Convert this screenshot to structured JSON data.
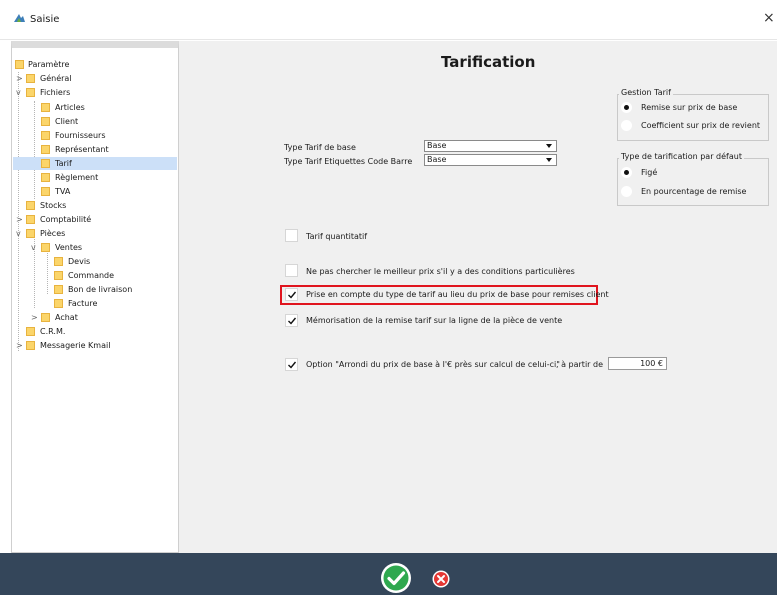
{
  "window": {
    "title": "Saisie",
    "close_glyph": "×"
  },
  "icons": {
    "app": "app-logo-icon",
    "close": "close-icon",
    "folder": "folder-icon",
    "ok": "ok-check-icon",
    "cancel": "cancel-x-icon"
  },
  "colors": {
    "footer": "#34465a",
    "panel": "#f0f0f0",
    "selected": "#cce0f8",
    "highlight": "#e0141e",
    "folder": "#fbd56a",
    "ok": "#2fa84f",
    "cancel": "#e53935"
  },
  "tree": {
    "items": [
      {
        "label": "Paramètre"
      },
      {
        "label": "Général",
        "toggle": ">"
      },
      {
        "label": "Fichiers",
        "toggle": "v"
      },
      {
        "label": "Articles"
      },
      {
        "label": "Client"
      },
      {
        "label": "Fournisseurs"
      },
      {
        "label": "Représentant"
      },
      {
        "label": "Tarif",
        "selected": true
      },
      {
        "label": "Règlement"
      },
      {
        "label": "TVA"
      },
      {
        "label": "Stocks"
      },
      {
        "label": "Comptabilité",
        "toggle": ">"
      },
      {
        "label": "Pièces",
        "toggle": "v"
      },
      {
        "label": "Ventes",
        "toggle": "v"
      },
      {
        "label": "Devis"
      },
      {
        "label": "Commande"
      },
      {
        "label": "Bon de livraison"
      },
      {
        "label": "Facture"
      },
      {
        "label": "Achat",
        "toggle": ">"
      },
      {
        "label": "C.R.M."
      },
      {
        "label": "Messagerie Kmail",
        "toggle": ">"
      }
    ]
  },
  "main": {
    "title": "Tarification",
    "gestion": {
      "legend": "Gestion Tarif",
      "options": [
        {
          "label": "Remise sur prix de base",
          "checked": true
        },
        {
          "label": "Coefficient sur prix de revient",
          "checked": false
        }
      ]
    },
    "type_defaut": {
      "legend": "Type de tarification par défaut",
      "options": [
        {
          "label": "Figé",
          "checked": true
        },
        {
          "label": "En pourcentage de remise",
          "checked": false
        }
      ]
    },
    "type_base": {
      "label": "Type Tarif de base",
      "value": "Base"
    },
    "type_etiquettes": {
      "label": "Type Tarif Etiquettes Code Barre",
      "value": "Base"
    },
    "checks": [
      {
        "label": "Tarif quantitatif",
        "checked": false
      },
      {
        "label": "Ne pas chercher le meilleur prix s'il y a des conditions particulières",
        "checked": false
      },
      {
        "label": "Prise en compte du type de tarif au lieu du prix de base pour remises client",
        "checked": true
      },
      {
        "label": "Mémorisation de la remise tarif sur la ligne de la pièce de vente",
        "checked": true
      },
      {
        "label": "Option \"Arrondi du prix de base à l'€ près sur calcul de celui-ci\"",
        "checked": true
      }
    ],
    "arrondi_suffix": ", à partir de",
    "arrondi_value": "100 €"
  }
}
